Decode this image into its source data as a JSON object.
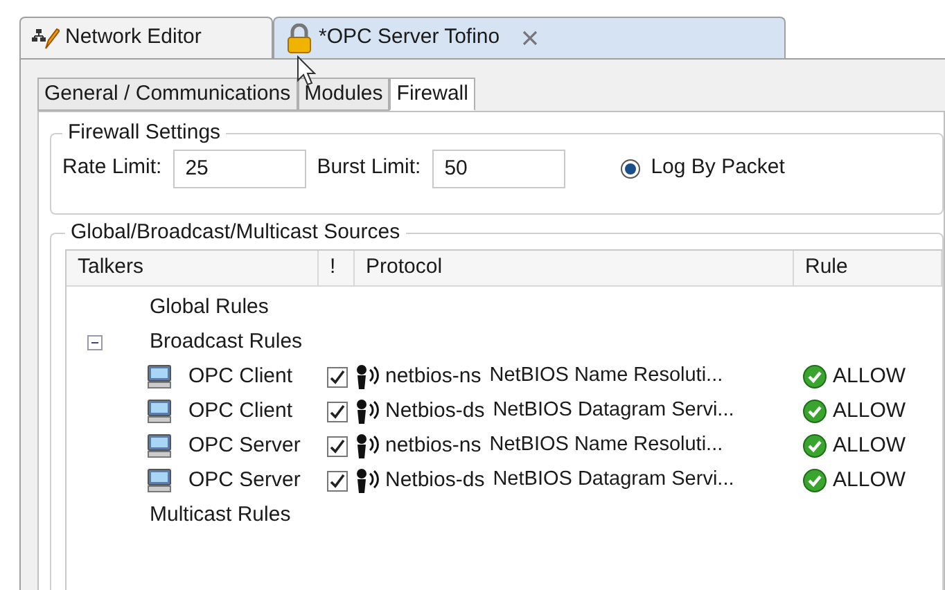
{
  "editor_tabs": [
    {
      "label": "Network Editor",
      "selected": false,
      "kind": "network"
    },
    {
      "label": "*OPC Server Tofino",
      "selected": true,
      "kind": "locked"
    }
  ],
  "inner_tabs": [
    {
      "label": "General / Communications",
      "selected": false
    },
    {
      "label": "Modules",
      "selected": false
    },
    {
      "label": "Firewall",
      "selected": true
    }
  ],
  "firewall_settings": {
    "title": "Firewall Settings",
    "rate_limit": {
      "label": "Rate Limit:",
      "value": "25"
    },
    "burst_limit": {
      "label": "Burst Limit:",
      "value": "50"
    },
    "log_by_packet": {
      "label": "Log By Packet",
      "selected": true
    }
  },
  "sources": {
    "title": "Global/Broadcast/Multicast Sources",
    "columns": [
      "Talkers",
      "!",
      "Protocol",
      "Rule"
    ],
    "groups": [
      {
        "label": "Global Rules"
      },
      {
        "label": "Broadcast Rules",
        "expanded": true,
        "children": [
          {
            "talker": "OPC Client",
            "checked": true,
            "protocol": "netbios-ns",
            "description": "NetBIOS Name Resoluti...",
            "rule": "ALLOW"
          },
          {
            "talker": "OPC Client",
            "checked": true,
            "protocol": "Netbios-ds",
            "description": "NetBIOS Datagram Servi...",
            "rule": "ALLOW"
          },
          {
            "talker": "OPC Server",
            "checked": true,
            "protocol": "netbios-ns",
            "description": "NetBIOS Name Resoluti...",
            "rule": "ALLOW"
          },
          {
            "talker": "OPC Server",
            "checked": true,
            "protocol": "Netbios-ds",
            "description": "NetBIOS Datagram Servi...",
            "rule": "ALLOW"
          }
        ]
      },
      {
        "label": "Multicast Rules"
      }
    ]
  }
}
